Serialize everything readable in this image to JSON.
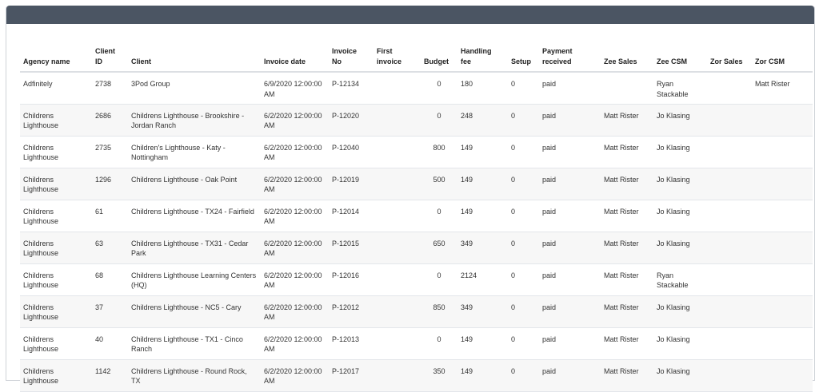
{
  "table": {
    "headers": [
      {
        "line1": "Agency name",
        "line2": ""
      },
      {
        "line1": "Client",
        "line2": "ID"
      },
      {
        "line1": "Client",
        "line2": ""
      },
      {
        "line1": "Invoice date",
        "line2": ""
      },
      {
        "line1": "Invoice",
        "line2": "No"
      },
      {
        "line1": "First",
        "line2": "invoice"
      },
      {
        "line1": "Budget",
        "line2": ""
      },
      {
        "line1": "Handling",
        "line2": "fee"
      },
      {
        "line1": "Setup",
        "line2": ""
      },
      {
        "line1": "Payment",
        "line2": "received"
      },
      {
        "line1": "Zee Sales",
        "line2": ""
      },
      {
        "line1": "Zee CSM",
        "line2": ""
      },
      {
        "line1": "Zor Sales",
        "line2": ""
      },
      {
        "line1": "Zor CSM",
        "line2": ""
      }
    ],
    "rows": [
      [
        "Adfinitely",
        "2738",
        "3Pod Group",
        "6/9/2020 12:00:00 AM",
        "P-12134",
        "",
        "0",
        "180",
        "0",
        "paid",
        "",
        "Ryan Stackable",
        "",
        "Matt Rister"
      ],
      [
        "Childrens Lighthouse",
        "2686",
        "Childrens Lighthouse - Brookshire - Jordan Ranch",
        "6/2/2020 12:00:00 AM",
        "P-12020",
        "",
        "0",
        "248",
        "0",
        "paid",
        "Matt Rister",
        "Jo Klasing",
        "",
        ""
      ],
      [
        "Childrens Lighthouse",
        "2735",
        "Children's Lighthouse - Katy - Nottingham",
        "6/2/2020 12:00:00 AM",
        "P-12040",
        "",
        "800",
        "149",
        "0",
        "paid",
        "Matt Rister",
        "Jo Klasing",
        "",
        ""
      ],
      [
        "Childrens Lighthouse",
        "1296",
        "Childrens Lighthouse - Oak Point",
        "6/2/2020 12:00:00 AM",
        "P-12019",
        "",
        "500",
        "149",
        "0",
        "paid",
        "Matt Rister",
        "Jo Klasing",
        "",
        ""
      ],
      [
        "Childrens Lighthouse",
        "61",
        "Childrens Lighthouse - TX24 - Fairfield",
        "6/2/2020 12:00:00 AM",
        "P-12014",
        "",
        "0",
        "149",
        "0",
        "paid",
        "Matt Rister",
        "Jo Klasing",
        "",
        ""
      ],
      [
        "Childrens Lighthouse",
        "63",
        "Childrens Lighthouse - TX31 - Cedar Park",
        "6/2/2020 12:00:00 AM",
        "P-12015",
        "",
        "650",
        "349",
        "0",
        "paid",
        "Matt Rister",
        "Jo Klasing",
        "",
        ""
      ],
      [
        "Childrens Lighthouse",
        "68",
        "Childrens Lighthouse Learning Centers (HQ)",
        "6/2/2020 12:00:00 AM",
        "P-12016",
        "",
        "0",
        "2124",
        "0",
        "paid",
        "Matt Rister",
        "Ryan Stackable",
        "",
        ""
      ],
      [
        "Childrens Lighthouse",
        "37",
        "Childrens Lighthouse - NC5 - Cary",
        "6/2/2020 12:00:00 AM",
        "P-12012",
        "",
        "850",
        "349",
        "0",
        "paid",
        "Matt Rister",
        "Jo Klasing",
        "",
        ""
      ],
      [
        "Childrens Lighthouse",
        "40",
        "Childrens Lighthouse - TX1 - Cinco Ranch",
        "6/2/2020 12:00:00 AM",
        "P-12013",
        "",
        "0",
        "149",
        "0",
        "paid",
        "Matt Rister",
        "Jo Klasing",
        "",
        ""
      ],
      [
        "Childrens Lighthouse",
        "1142",
        "Childrens Lighthouse - Round Rock, TX",
        "6/2/2020 12:00:00 AM",
        "P-12017",
        "",
        "350",
        "149",
        "0",
        "paid",
        "Matt Rister",
        "Jo Klasing",
        "",
        ""
      ]
    ]
  }
}
